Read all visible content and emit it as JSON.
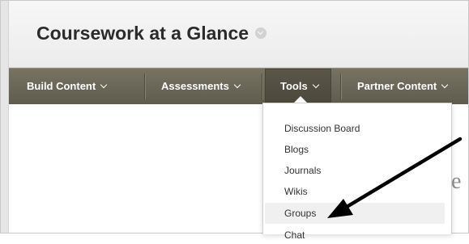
{
  "page": {
    "title": "Coursework at a Glance"
  },
  "menubar": {
    "items": [
      {
        "label": "Build Content"
      },
      {
        "label": "Assessments"
      },
      {
        "label": "Tools"
      },
      {
        "label": "Partner Content"
      }
    ],
    "active_item": "Tools"
  },
  "tools_dropdown": {
    "items": [
      {
        "label": "Discussion Board"
      },
      {
        "label": "Blogs"
      },
      {
        "label": "Journals"
      },
      {
        "label": "Wikis"
      },
      {
        "label": "Groups"
      },
      {
        "label": "Chat"
      }
    ],
    "highlighted_item": "Groups"
  },
  "annotation": {
    "type": "arrow",
    "points_to": "Groups",
    "color": "#000000"
  },
  "colors": {
    "menubar": "#6b6858",
    "menu_text": "#ffffff",
    "title_text": "#2b2b2b",
    "highlight": "#f0f0f0"
  }
}
